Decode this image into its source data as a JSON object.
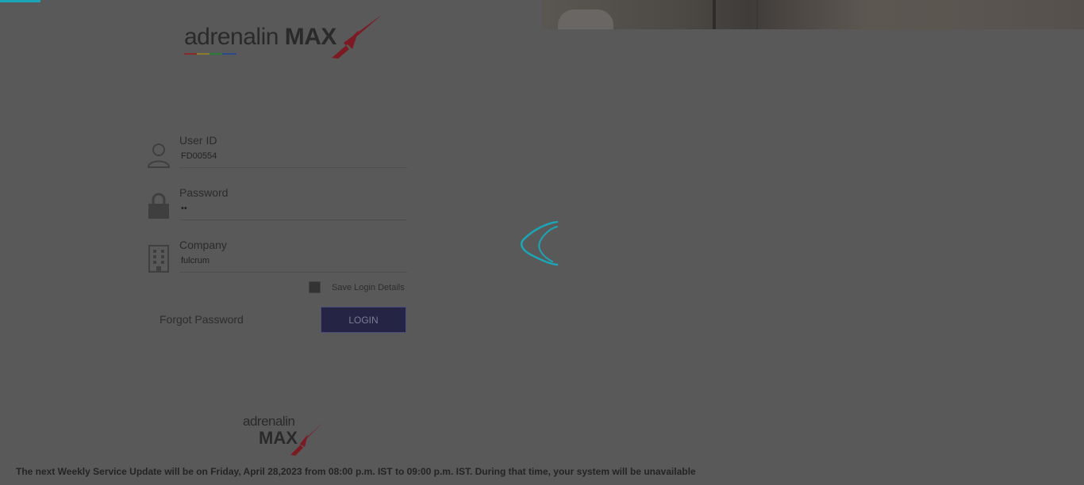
{
  "brand": {
    "logo_text": "adrenalin",
    "logo_max": "MAX",
    "footer_logo_text": "adrenalin",
    "footer_logo_max": "MAX"
  },
  "login_form": {
    "user_id": {
      "label": "User ID",
      "value": "FD00554",
      "icon": "user-icon"
    },
    "password": {
      "label": "Password",
      "value": "••",
      "icon": "lock-icon"
    },
    "company": {
      "label": "Company",
      "value": "fulcrum",
      "icon": "building-icon"
    },
    "save_login_label": "Save Login Details",
    "save_login_checked": false,
    "forgot_password_label": "Forgot Password",
    "login_button_label": "LOGIN"
  },
  "loading": {
    "icon": "loading-spinner-icon",
    "accent_color": "#1aa6b7"
  },
  "notice": "The next Weekly Service Update will be on Friday, April 28,2023 from 08:00 p.m. IST to 09:00 p.m. IST. During that time, your system will be unavailable",
  "colors": {
    "overlay": "#595959",
    "button_bg": "#262445",
    "logo_accent": "#b01e2a"
  }
}
